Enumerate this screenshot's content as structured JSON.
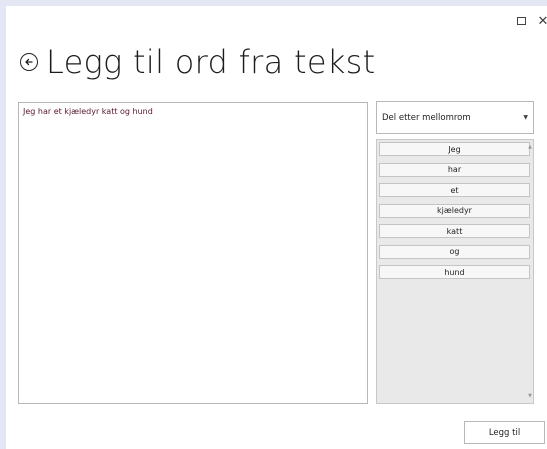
{
  "window": {
    "maximize_icon": "maximize-icon",
    "close_glyph": "✕"
  },
  "header": {
    "title": "Legg til ord fra tekst",
    "back_icon": "back-arrow-circle-icon"
  },
  "input": {
    "text": "Jeg har et kjæledyr katt og hund"
  },
  "split_mode": {
    "selected": "Del etter mellomrom"
  },
  "words": [
    "Jeg",
    "har",
    "et",
    "kjæledyr",
    "katt",
    "og",
    "hund"
  ],
  "actions": {
    "add_label": "Legg til"
  },
  "colors": {
    "input_text": "#5a1630",
    "background": "#e5e6f3"
  }
}
